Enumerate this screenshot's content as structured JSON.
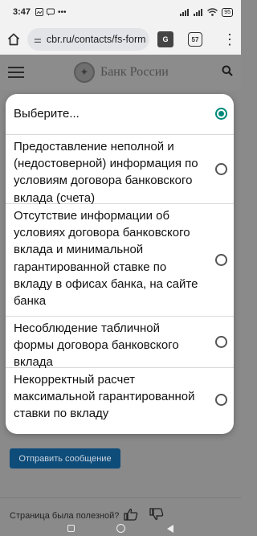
{
  "status_bar": {
    "time": "3:47",
    "battery": "95",
    "icons": [
      "gallery-icon",
      "message-icon",
      "dots-icon",
      "signal-icon",
      "signal-icon",
      "wifi-icon",
      "battery-icon"
    ]
  },
  "browser": {
    "url": "cbr.ru/contacts/fs-form",
    "tab_count": "57",
    "translate_label": "G"
  },
  "header": {
    "brand": "Банк России"
  },
  "page": {
    "send_button": "Отправить сообщение",
    "feedback_question": "Страница была полезной?"
  },
  "dialog": {
    "options": [
      {
        "label": "Выберите...",
        "selected": true
      },
      {
        "label": "Предоставление неполной и (недостоверной) информация по условиям договора банковского вклада (счета)",
        "selected": false
      },
      {
        "label": "Отсутствие информации об условиях договора банковского вклада и минимальной гарантированной ставке по вкладу в офисах банка, на сайте банка",
        "selected": false
      },
      {
        "label": "Несоблюдение табличной формы договора банковского вклада",
        "selected": false
      },
      {
        "label": "Некорректный расчет максимальной гарантированной ставки по вкладу",
        "selected": false
      }
    ]
  },
  "colors": {
    "accent_radio": "#00897b",
    "send_button": "#0e4c7a"
  }
}
